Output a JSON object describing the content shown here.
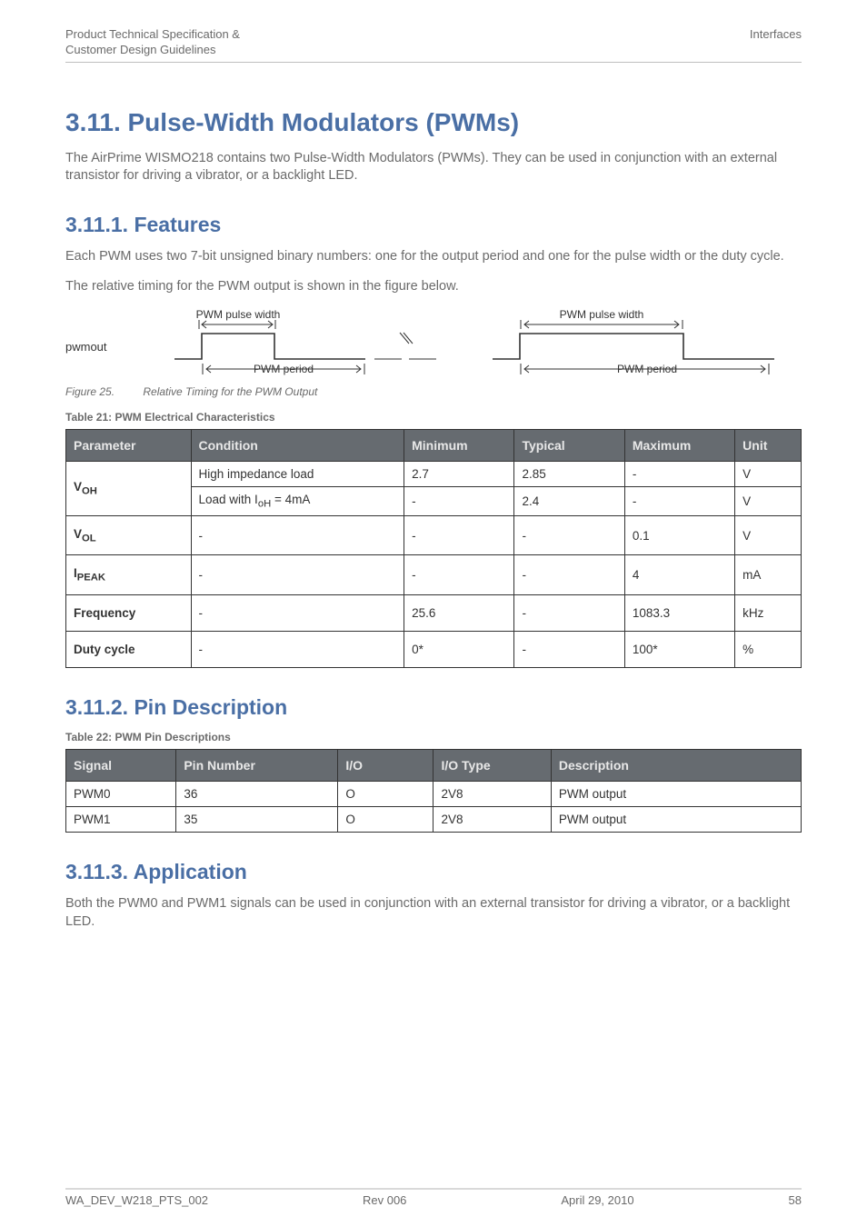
{
  "header": {
    "left_line1": "Product Technical Specification &",
    "left_line2": "Customer Design Guidelines",
    "right": "Interfaces"
  },
  "main_heading": "3.11.   Pulse-Width Modulators (PWMs)",
  "intro_paragraph": "The AirPrime WISMO218 contains two Pulse-Width Modulators (PWMs). They can be used in conjunction with an external transistor for driving a vibrator, or a backlight LED.",
  "features": {
    "heading": "3.11.1.   Features",
    "para1": "Each PWM uses two 7-bit unsigned binary numbers: one for the output period and one for the pulse width or the duty cycle.",
    "para2": "The relative timing for the PWM output is shown in the figure below."
  },
  "figure": {
    "pwmout_label": "pwmout",
    "pulse_width_label": "PWM pulse width",
    "period_label": "PWM period",
    "caption_label": "Figure 25.",
    "caption_text": "Relative Timing for the PWM Output"
  },
  "table21": {
    "caption": "Table 21:    PWM Electrical Characteristics",
    "headers": [
      "Parameter",
      "Condition",
      "Minimum",
      "Typical",
      "Maximum",
      "Unit"
    ],
    "rows": [
      {
        "param_html": "V<sub>OH</sub>",
        "cond": "High impedance load",
        "min": "2.7",
        "typ": "2.85",
        "max": "-",
        "unit": "V"
      },
      {
        "param_html": "",
        "cond_html": "Load with I<sub>oH</sub> = 4mA",
        "min": "-",
        "typ": "2.4",
        "max": "-",
        "unit": "V"
      },
      {
        "param_html": "V<sub>OL</sub>",
        "cond": "-",
        "min": "-",
        "typ": "-",
        "max": "0.1",
        "unit": "V"
      },
      {
        "param_html": "I<sub>PEAK</sub>",
        "cond": "-",
        "min": "-",
        "typ": "-",
        "max": "4",
        "unit": "mA"
      },
      {
        "param_html": "Frequency",
        "cond": "-",
        "min": "25.6",
        "typ": "-",
        "max": "1083.3",
        "unit": "kHz"
      },
      {
        "param_html": "Duty cycle",
        "cond": "-",
        "min": "0*",
        "typ": "-",
        "max": "100*",
        "unit": "%"
      }
    ]
  },
  "pin_desc": {
    "heading": "3.11.2.   Pin Description",
    "caption": "Table 22:    PWM Pin Descriptions",
    "headers": [
      "Signal",
      "Pin Number",
      "I/O",
      "I/O Type",
      "Description"
    ],
    "rows": [
      {
        "signal": "PWM0",
        "pin": "36",
        "io": "O",
        "iotype": "2V8",
        "desc": "PWM output"
      },
      {
        "signal": "PWM1",
        "pin": "35",
        "io": "O",
        "iotype": "2V8",
        "desc": "PWM output"
      }
    ]
  },
  "application": {
    "heading": "3.11.3.   Application",
    "para": "Both the PWM0 and PWM1 signals can be used in conjunction with an external transistor for driving a vibrator, or a backlight LED."
  },
  "footer": {
    "left": "WA_DEV_W218_PTS_002",
    "center": "Rev 006",
    "right_date": "April 29, 2010",
    "page": "58"
  }
}
